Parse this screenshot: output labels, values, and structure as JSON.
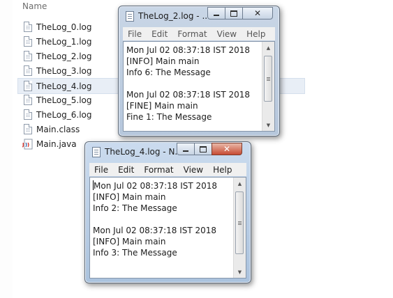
{
  "explorer": {
    "column_header": "Name",
    "files": [
      {
        "name": "TheLog_0.log",
        "icon": "text-file-icon",
        "selected": false
      },
      {
        "name": "TheLog_1.log",
        "icon": "text-file-icon",
        "selected": false
      },
      {
        "name": "TheLog_2.log",
        "icon": "text-file-icon",
        "selected": false
      },
      {
        "name": "TheLog_3.log",
        "icon": "text-file-icon",
        "selected": false
      },
      {
        "name": "TheLog_4.log",
        "icon": "text-file-icon",
        "selected": true
      },
      {
        "name": "TheLog_5.log",
        "icon": "text-file-icon",
        "selected": false
      },
      {
        "name": "TheLog_6.log",
        "icon": "text-file-icon",
        "selected": false
      },
      {
        "name": "Main.class",
        "icon": "text-file-icon",
        "selected": false
      },
      {
        "name": "Main.java",
        "icon": "java-file-icon",
        "selected": false
      }
    ]
  },
  "window_back": {
    "title": "TheLog_2.log - ...",
    "menu": [
      "File",
      "Edit",
      "Format",
      "View",
      "Help"
    ],
    "lines": [
      "Mon Jul 02 08:37:18 IST 2018",
      "[INFO] Main main",
      "Info 6: The Message",
      "",
      "Mon Jul 02 08:37:18 IST 2018",
      "[FINE] Main main",
      "Fine 1: The Message"
    ]
  },
  "window_front": {
    "title": "TheLog_4.log - N...",
    "menu": [
      "File",
      "Edit",
      "Format",
      "View",
      "Help"
    ],
    "lines": [
      "Mon Jul 02 08:37:18 IST 2018",
      "[INFO] Main main",
      "Info 2: The Message",
      "",
      "Mon Jul 02 08:37:18 IST 2018",
      "[INFO] Main main",
      "Info 3: The Message"
    ]
  },
  "colors": {
    "selection": "#e8eef6",
    "close_active": "#c74b33",
    "titlebar": "#b6c7dc"
  }
}
